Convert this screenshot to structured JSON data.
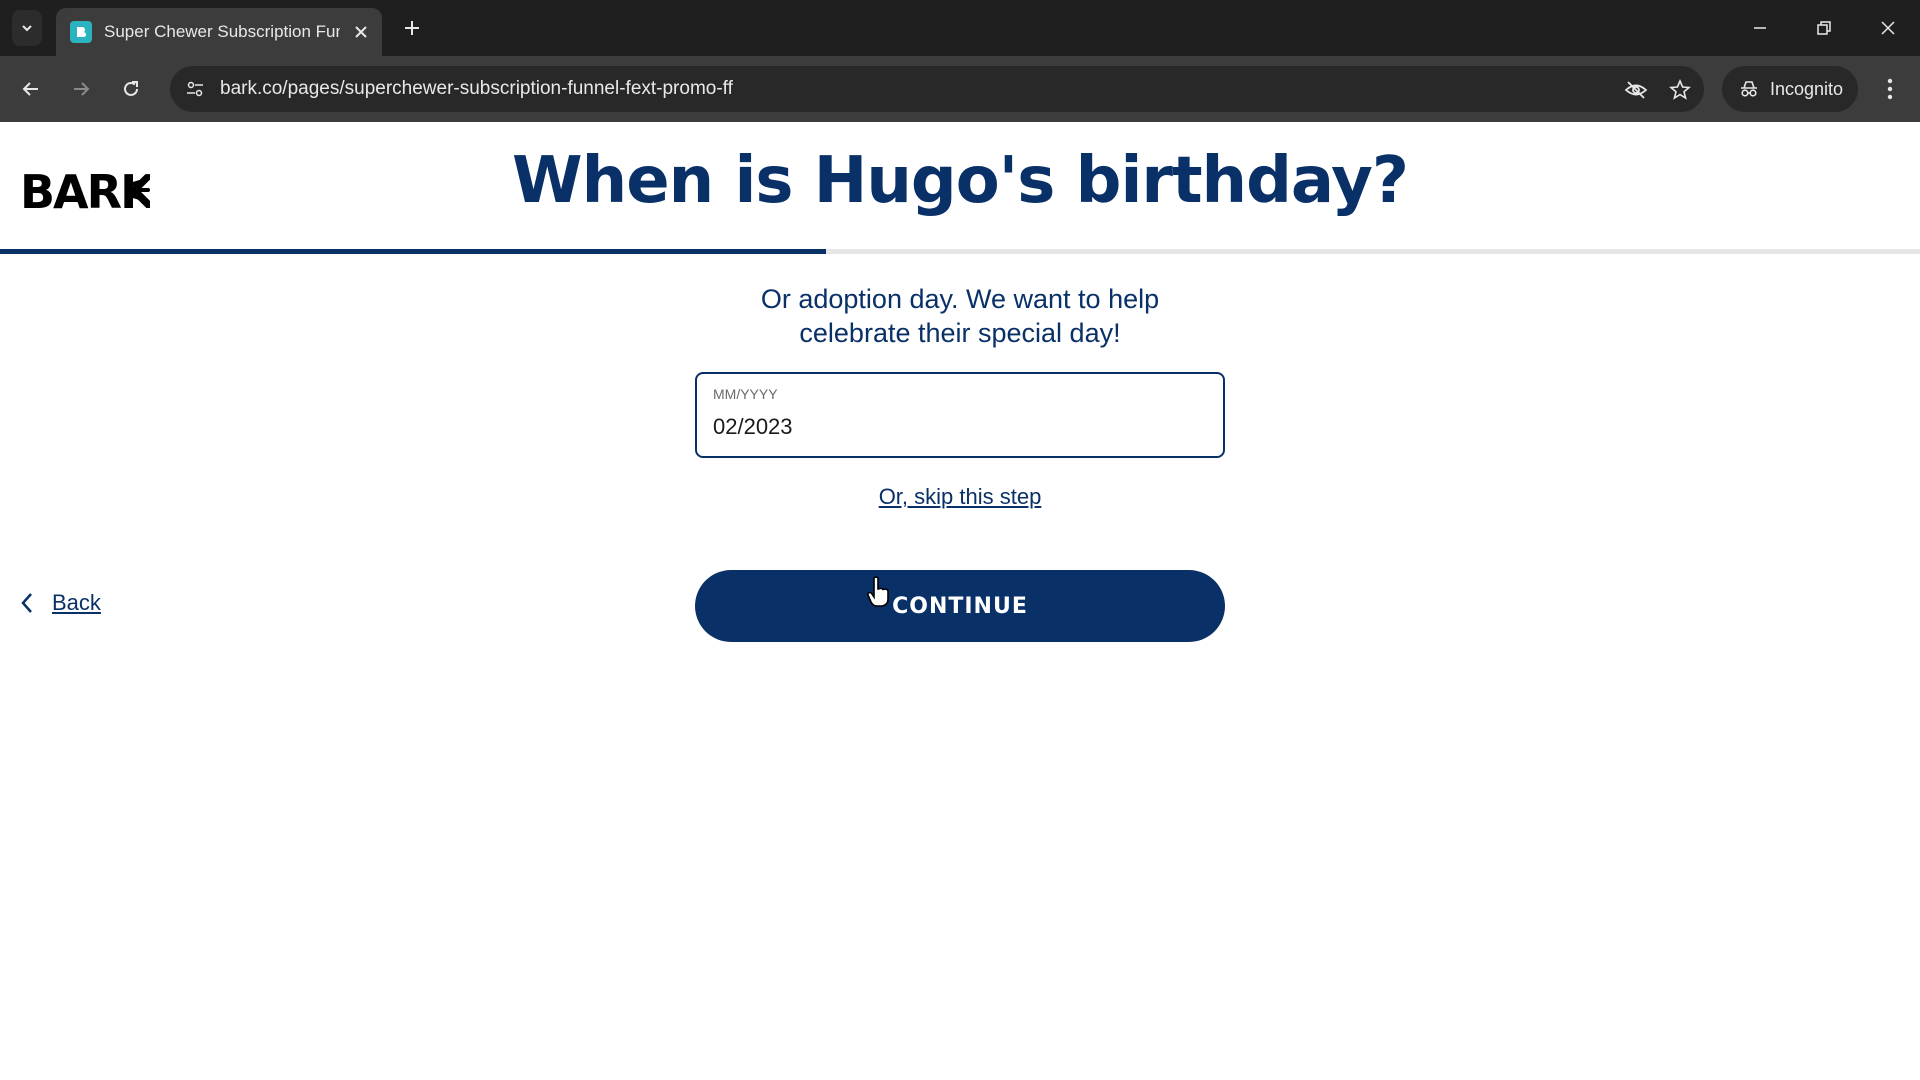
{
  "browser": {
    "tab_title": "Super Chewer Subscription Fun",
    "url": "bark.co/pages/superchewer-subscription-funnel-fext-promo-ff",
    "incognito_label": "Incognito"
  },
  "page": {
    "logo_text": "BARK",
    "heading": "When is Hugo's birthday?",
    "subtitle_line1": "Or adoption day. We want to help",
    "subtitle_line2": "celebrate their special day!",
    "date_field": {
      "label": "MM/YYYY",
      "value": "02/2023"
    },
    "skip_label": "Or, skip this step",
    "back_label": "Back",
    "continue_label": "CONTINUE",
    "progress_fraction": 0.43
  },
  "colors": {
    "brand_navy": "#0a3068",
    "chrome_dark": "#1f1f1f",
    "toolbar": "#3c3c3c"
  }
}
